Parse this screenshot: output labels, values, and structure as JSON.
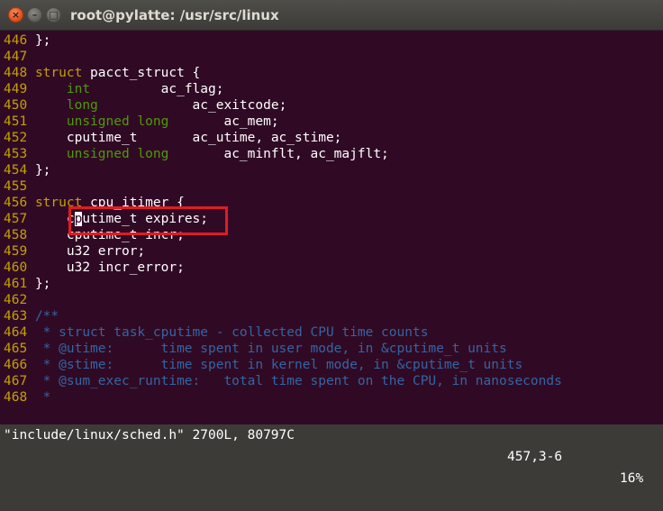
{
  "window": {
    "title": "root@pylatte: /usr/src/linux",
    "close_glyph": "×",
    "min_glyph": "–",
    "max_glyph": "□"
  },
  "code": {
    "lines": [
      {
        "n": "446",
        "parts": [
          {
            "t": "};",
            "c": "plain"
          }
        ]
      },
      {
        "n": "447",
        "parts": []
      },
      {
        "n": "448",
        "parts": [
          {
            "t": "struct",
            "c": "kw"
          },
          {
            "t": " pacct_struct {",
            "c": "plain"
          }
        ]
      },
      {
        "n": "449",
        "parts": [
          {
            "t": "    ",
            "c": "plain"
          },
          {
            "t": "int",
            "c": "ty"
          },
          {
            "t": "         ac_flag;",
            "c": "plain"
          }
        ]
      },
      {
        "n": "450",
        "parts": [
          {
            "t": "    ",
            "c": "plain"
          },
          {
            "t": "long",
            "c": "ty"
          },
          {
            "t": "            ac_exitcode;",
            "c": "plain"
          }
        ]
      },
      {
        "n": "451",
        "parts": [
          {
            "t": "    ",
            "c": "plain"
          },
          {
            "t": "unsigned long",
            "c": "ty"
          },
          {
            "t": "       ac_mem;",
            "c": "plain"
          }
        ]
      },
      {
        "n": "452",
        "parts": [
          {
            "t": "    cputime_t       ac_utime, ac_stime;",
            "c": "plain"
          }
        ]
      },
      {
        "n": "453",
        "parts": [
          {
            "t": "    ",
            "c": "plain"
          },
          {
            "t": "unsigned long",
            "c": "ty"
          },
          {
            "t": "       ac_minflt, ac_majflt;",
            "c": "plain"
          }
        ]
      },
      {
        "n": "454",
        "parts": [
          {
            "t": "};",
            "c": "plain"
          }
        ]
      },
      {
        "n": "455",
        "parts": []
      },
      {
        "n": "456",
        "parts": [
          {
            "t": "struct",
            "c": "kw"
          },
          {
            "t": " cpu_itimer {",
            "c": "plain"
          }
        ]
      },
      {
        "n": "457",
        "parts": [
          {
            "t": "    c",
            "c": "plain"
          },
          {
            "t": "p",
            "c": "cursor"
          },
          {
            "t": "utime_t expires;",
            "c": "plain"
          }
        ]
      },
      {
        "n": "458",
        "parts": [
          {
            "t": "    cputime_t incr;",
            "c": "plain"
          }
        ]
      },
      {
        "n": "459",
        "parts": [
          {
            "t": "    u32 error;",
            "c": "plain"
          }
        ]
      },
      {
        "n": "460",
        "parts": [
          {
            "t": "    u32 incr_error;",
            "c": "plain"
          }
        ]
      },
      {
        "n": "461",
        "parts": [
          {
            "t": "};",
            "c": "plain"
          }
        ]
      },
      {
        "n": "462",
        "parts": []
      },
      {
        "n": "463",
        "parts": [
          {
            "t": "/**",
            "c": "cm"
          }
        ]
      },
      {
        "n": "464",
        "parts": [
          {
            "t": " * struct task_cputime - collected CPU time counts",
            "c": "cm"
          }
        ]
      },
      {
        "n": "465",
        "parts": [
          {
            "t": " * @utime:      time spent in user mode, in &cputime_t units",
            "c": "cm"
          }
        ]
      },
      {
        "n": "466",
        "parts": [
          {
            "t": " * @stime:      time spent in kernel mode, in &cputime_t units",
            "c": "cm"
          }
        ]
      },
      {
        "n": "467",
        "parts": [
          {
            "t": " * @sum_exec_runtime:   total time spent on the CPU, in nanoseconds",
            "c": "cm"
          }
        ]
      },
      {
        "n": "468",
        "parts": [
          {
            "t": " *",
            "c": "cm"
          }
        ]
      }
    ]
  },
  "status": {
    "file": "\"include/linux/sched.h\" 2700L, 80797C",
    "position": "457,3-6",
    "percent": "16%"
  },
  "colors": {
    "background": "#300a24",
    "line_number": "#c4a000",
    "keyword": "#c4a000",
    "type": "#4e9a06",
    "comment": "#3465a4",
    "highlight_box": "#e01b24"
  }
}
